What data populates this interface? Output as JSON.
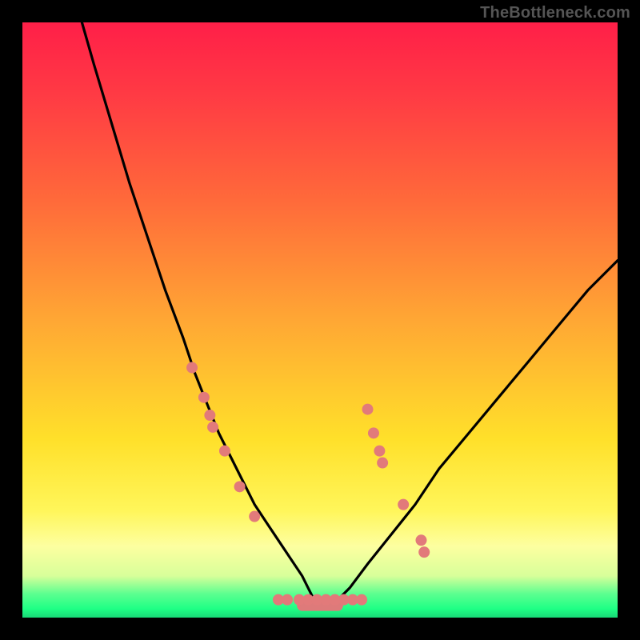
{
  "watermark": "TheBottleneck.com",
  "chart_data": {
    "type": "line",
    "title": "",
    "xlabel": "",
    "ylabel": "",
    "xlim": [
      0,
      100
    ],
    "ylim": [
      0,
      100
    ],
    "annotations": [],
    "series": [
      {
        "name": "bottleneck-curve",
        "color": "#000000",
        "x": [
          10,
          12,
          15,
          18,
          21,
          24,
          27,
          29,
          31,
          33,
          35,
          37,
          39,
          41,
          43,
          45,
          47,
          48,
          49,
          50,
          51,
          52,
          53,
          55,
          58,
          62,
          66,
          70,
          75,
          80,
          85,
          90,
          95,
          100
        ],
        "y": [
          100,
          93,
          83,
          73,
          64,
          55,
          47,
          41,
          36,
          31,
          27,
          23,
          19,
          16,
          13,
          10,
          7,
          5,
          3,
          2,
          2,
          2,
          3,
          5,
          9,
          14,
          19,
          25,
          31,
          37,
          43,
          49,
          55,
          60
        ]
      },
      {
        "name": "markers-left",
        "type": "scatter",
        "color": "#e27a7a",
        "x": [
          28.5,
          30.5,
          31.5,
          32.0,
          34.0,
          36.5,
          39.0
        ],
        "y": [
          42,
          37,
          34,
          32,
          28,
          22,
          17
        ]
      },
      {
        "name": "markers-right",
        "type": "scatter",
        "color": "#e27a7a",
        "x": [
          58.0,
          59.0,
          60.0,
          60.5,
          64.0,
          67.0,
          67.5
        ],
        "y": [
          35,
          31,
          28,
          26,
          19,
          13,
          11
        ]
      },
      {
        "name": "markers-bottom",
        "type": "scatter",
        "color": "#e27a7a",
        "x": [
          43.0,
          44.5,
          46.5,
          48.0,
          49.5,
          51.0,
          52.5,
          54.0,
          55.5,
          57.0
        ],
        "y": [
          3,
          3,
          3,
          3,
          3,
          3,
          3,
          3,
          3,
          3
        ]
      }
    ],
    "flat_segment": {
      "x0": 47,
      "x1": 53,
      "y": 2
    }
  }
}
